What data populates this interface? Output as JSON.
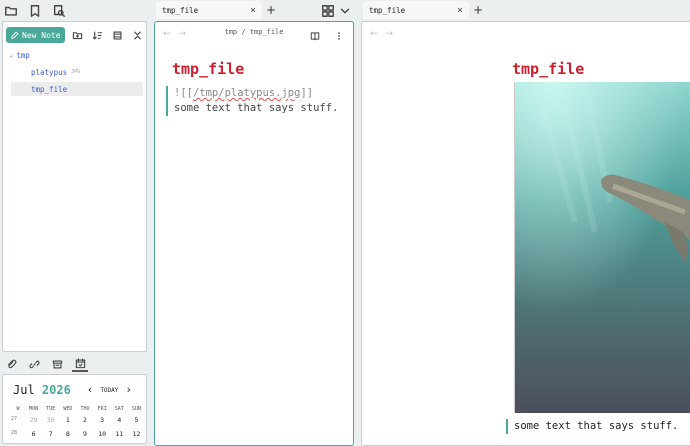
{
  "top_left_icons": [
    "folder-icon",
    "bookmark-icon",
    "search-files-icon"
  ],
  "explorer": {
    "new_note_label": "New Note",
    "toolbar_icons": [
      "new-folder-icon",
      "sort-icon",
      "collapse-icon",
      "close-all-icon"
    ],
    "tree": {
      "folder": "tmp",
      "files": [
        {
          "name": "platypus",
          "tag": "JPG",
          "selected": false
        },
        {
          "name": "tmp_file",
          "tag": "",
          "selected": true
        }
      ]
    }
  },
  "bottom_left_icons": [
    "attachment-icon",
    "link-icon",
    "archive-icon",
    "calendar-icon"
  ],
  "calendar": {
    "month": "Jul",
    "year": "2026",
    "today_label": "TODAY",
    "prev": "‹",
    "next": "›",
    "week_header": "W",
    "days_of_week": [
      "MON",
      "TUE",
      "WED",
      "THU",
      "FRI",
      "SAT",
      "SUN"
    ],
    "weeks": [
      {
        "week": "27",
        "days": [
          "29",
          "30",
          "1",
          "2",
          "3",
          "4",
          "5"
        ]
      },
      {
        "week": "28",
        "days": [
          "6",
          "7",
          "8",
          "9",
          "10",
          "11",
          "12"
        ]
      }
    ]
  },
  "tabs": {
    "left": {
      "label": "tmp_file",
      "close": "×"
    },
    "right": {
      "label": "tmp_file",
      "close": "×"
    },
    "plus": "+"
  },
  "pane1": {
    "breadcrumb": "tmp / tmp_file",
    "title": "tmp_file",
    "editor": {
      "link_open": "![[",
      "link_path": "/tmp/platypus.jpg",
      "link_close": "]]",
      "text": "some text that says stuff."
    }
  },
  "pane2": {
    "title": "tmp_file",
    "caption": "some text that says stuff."
  },
  "colors": {
    "accent": "#4aa89b",
    "title": "#cc1f2f",
    "link": "#3b5bd6"
  }
}
